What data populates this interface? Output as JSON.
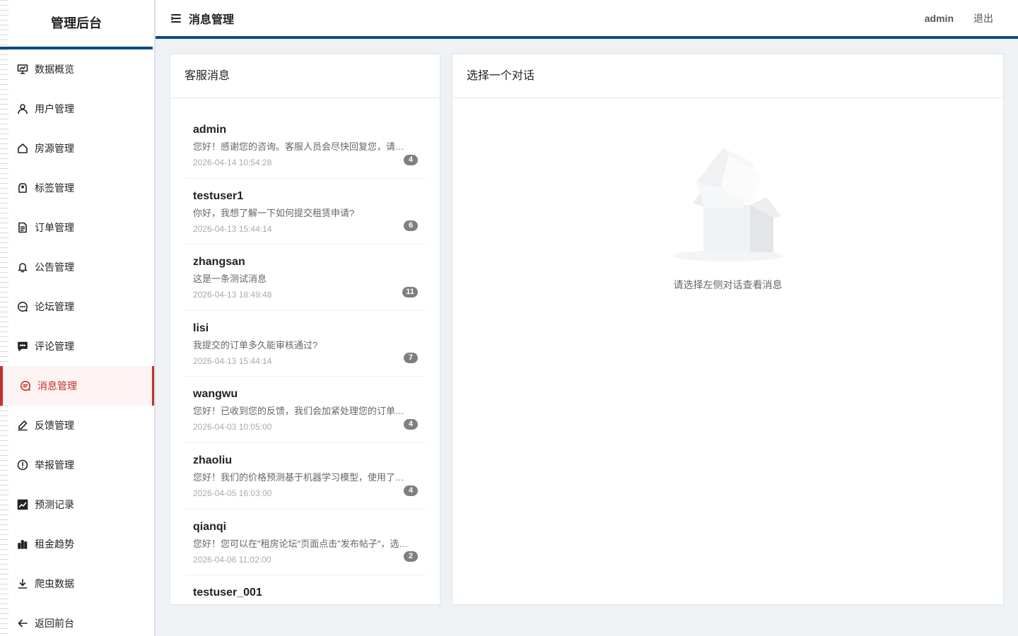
{
  "sidebar": {
    "brand": "管理后台",
    "items": [
      {
        "key": "dashboard",
        "label": "数据概览",
        "icon": "presentation-icon"
      },
      {
        "key": "users",
        "label": "用户管理",
        "icon": "user-icon"
      },
      {
        "key": "houses",
        "label": "房源管理",
        "icon": "home-icon"
      },
      {
        "key": "tags",
        "label": "标签管理",
        "icon": "tag-icon"
      },
      {
        "key": "orders",
        "label": "订单管理",
        "icon": "document-icon"
      },
      {
        "key": "notices",
        "label": "公告管理",
        "icon": "bell-icon"
      },
      {
        "key": "forum",
        "label": "论坛管理",
        "icon": "chat-dots-icon"
      },
      {
        "key": "comments",
        "label": "评论管理",
        "icon": "comment-icon"
      },
      {
        "key": "messages",
        "label": "消息管理",
        "icon": "message-icon",
        "active": true
      },
      {
        "key": "feedback",
        "label": "反馈管理",
        "icon": "edit-pen-icon"
      },
      {
        "key": "reports",
        "label": "举报管理",
        "icon": "warning-circle-icon"
      },
      {
        "key": "predictions",
        "label": "预测记录",
        "icon": "trend-chart-icon"
      },
      {
        "key": "rent-trend",
        "label": "租金趋势",
        "icon": "bar-chart-icon"
      },
      {
        "key": "crawler",
        "label": "爬虫数据",
        "icon": "download-icon"
      },
      {
        "key": "back",
        "label": "返回前台",
        "icon": "arrow-left-icon"
      }
    ]
  },
  "header": {
    "title": "消息管理",
    "user": "admin",
    "logout": "退出"
  },
  "list_panel": {
    "title": "客服消息",
    "conversations": [
      {
        "name": "admin",
        "preview": "您好！感谢您的咨询。客服人员会尽快回复您，请耐心等待。",
        "time": "2026-04-14 10:54:28",
        "count": "4"
      },
      {
        "name": "testuser1",
        "preview": "你好，我想了解一下如何提交租赁申请?",
        "time": "2026-04-13 15:44:14",
        "count": "6"
      },
      {
        "name": "zhangsan",
        "preview": "这是一条测试消息",
        "time": "2026-04-13 18:49:48",
        "count": "11"
      },
      {
        "name": "lisi",
        "preview": "我提交的订单多久能审核通过?",
        "time": "2026-04-13 15:44:14",
        "count": "7"
      },
      {
        "name": "wangwu",
        "preview": "您好！已收到您的反馈，我们会加紧处理您的订单申请。",
        "time": "2026-04-03 10:05:00",
        "count": "4"
      },
      {
        "name": "zhaoliu",
        "preview": "您好！我们的价格预测基于机器学习模型，使用了大量数据。",
        "time": "2026-04-05 16:03:00",
        "count": "4"
      },
      {
        "name": "qianqi",
        "preview": "您好！您可以在\"租房论坛\"页面点击\"发布帖子\"，选择分类。",
        "time": "2026-04-06 11:02:00",
        "count": "2"
      },
      {
        "name": "testuser_001",
        "preview": "",
        "time": "",
        "count": ""
      }
    ]
  },
  "chat_panel": {
    "title": "选择一个对话",
    "empty_text": "请选择左侧对话查看消息"
  },
  "colors": {
    "accent": "#c4302b",
    "header_border": "#0d4c87",
    "badge": "#7d7f83"
  }
}
